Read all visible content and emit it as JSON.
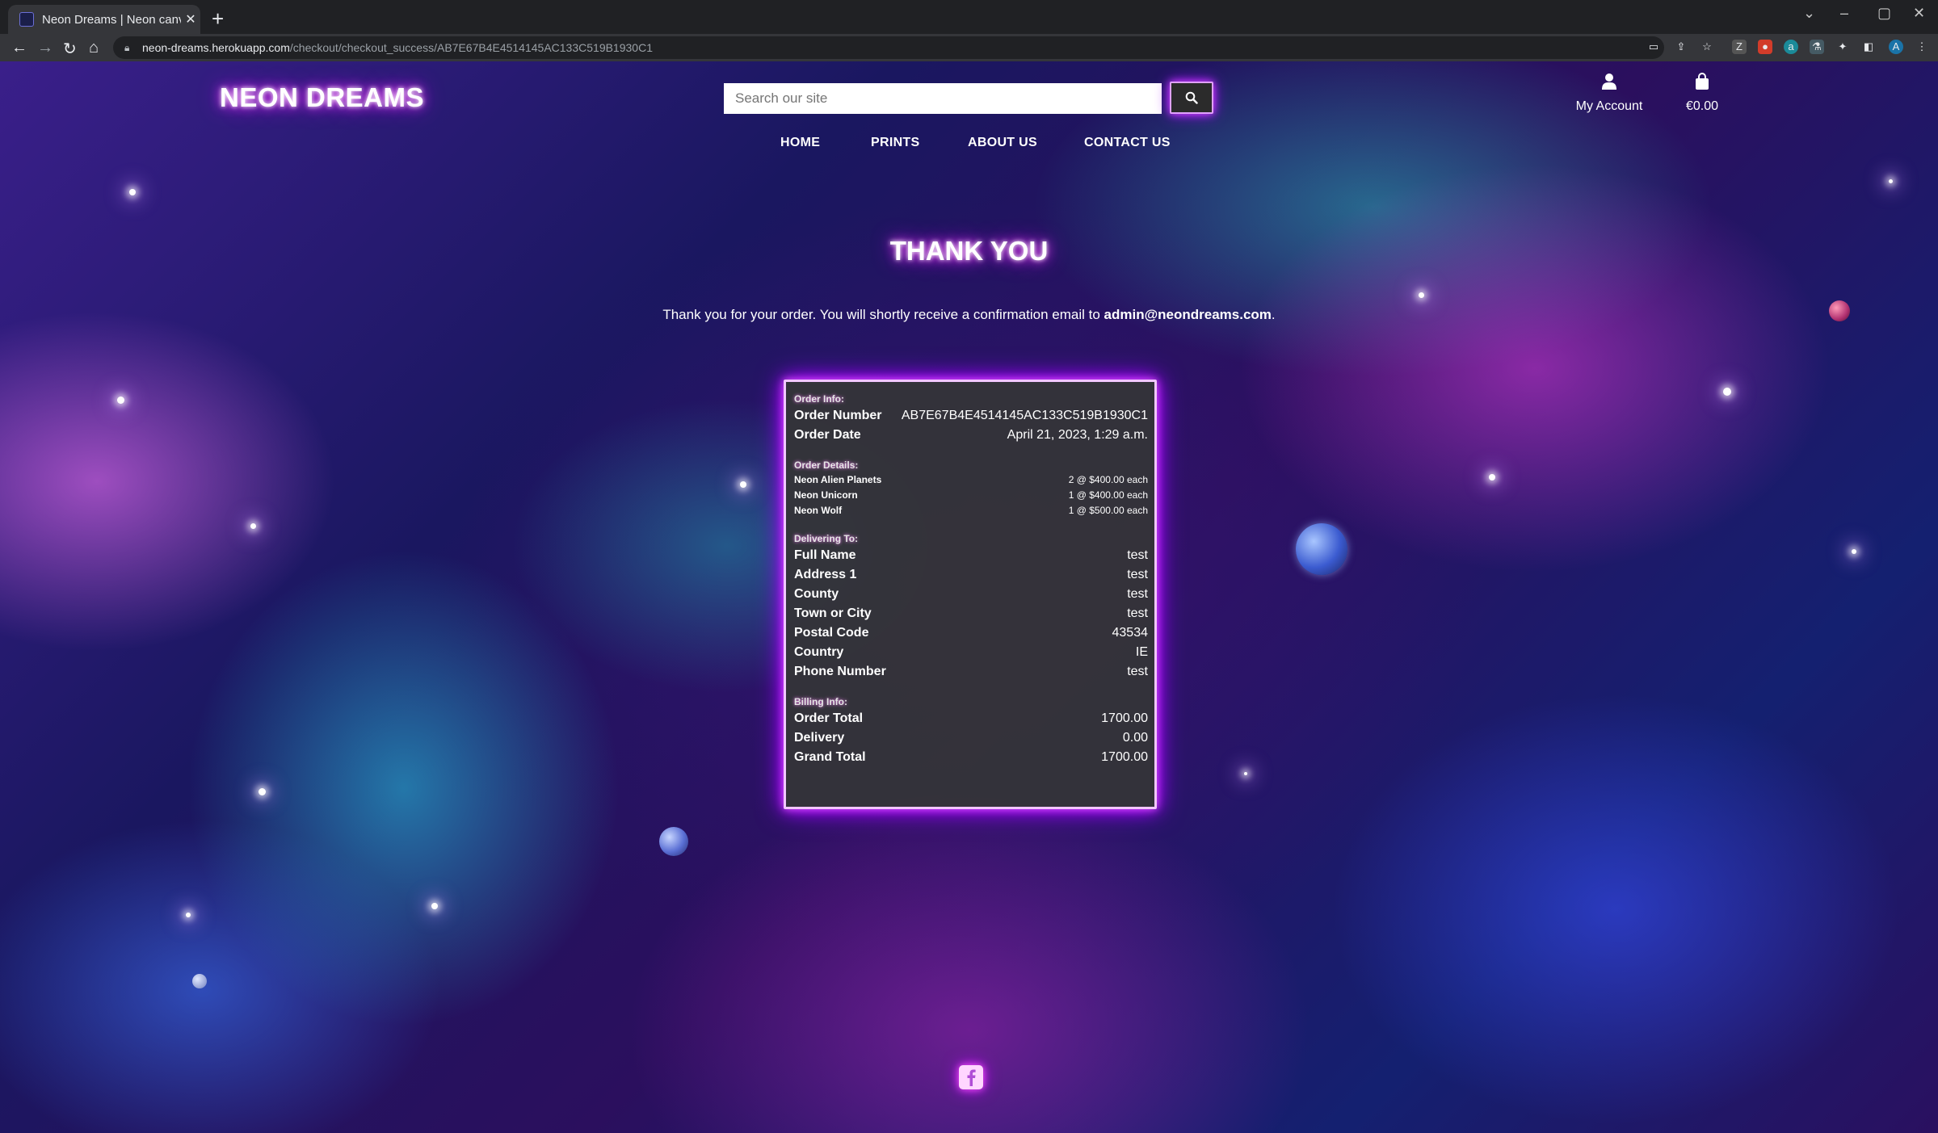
{
  "browser": {
    "tab_title": "Neon Dreams | Neon canvas prin",
    "tab_close": "✕",
    "new_tab": "+",
    "url_host": "neon-dreams.herokuapp.com",
    "url_path": "/checkout/checkout_success/AB7E67B4E4514145AC133C519B1930C1",
    "profile_initial": "A"
  },
  "header": {
    "logo": "NEON DREAMS",
    "search_placeholder": "Search our site",
    "account_label": "My Account",
    "bag_total": "€0.00"
  },
  "nav": [
    "HOME",
    "PRINTS",
    "ABOUT US",
    "CONTACT US"
  ],
  "main": {
    "heading": "THANK YOU",
    "message_prefix": "Thank you for your order. You will shortly receive a confirmation email to",
    "email": "admin@neondreams.com",
    "message_suffix": "."
  },
  "order": {
    "info_heading": "Order Info:",
    "order_number_label": "Order Number",
    "order_number": "AB7E67B4E4514145AC133C519B1930C1",
    "order_date_label": "Order Date",
    "order_date": "April 21, 2023, 1:29 a.m.",
    "details_heading": "Order Details:",
    "items": [
      {
        "name": "Neon Alien Planets",
        "qty": "2 @ $400.00 each"
      },
      {
        "name": "Neon Unicorn",
        "qty": "1 @ $400.00 each"
      },
      {
        "name": "Neon Wolf",
        "qty": "1 @ $500.00 each"
      }
    ],
    "delivery_heading": "Delivering To:",
    "delivery": [
      {
        "label": "Full Name",
        "value": "test"
      },
      {
        "label": "Address 1",
        "value": "test"
      },
      {
        "label": "County",
        "value": "test"
      },
      {
        "label": "Town or City",
        "value": "test"
      },
      {
        "label": "Postal Code",
        "value": "43534"
      },
      {
        "label": "Country",
        "value": "IE"
      },
      {
        "label": "Phone Number",
        "value": "test"
      }
    ],
    "billing_heading": "Billing Info:",
    "billing": [
      {
        "label": "Order Total",
        "value": "1700.00"
      },
      {
        "label": "Delivery",
        "value": "0.00"
      },
      {
        "label": "Grand Total",
        "value": "1700.00"
      }
    ]
  },
  "footer": {
    "social_icon": "facebook-icon"
  }
}
